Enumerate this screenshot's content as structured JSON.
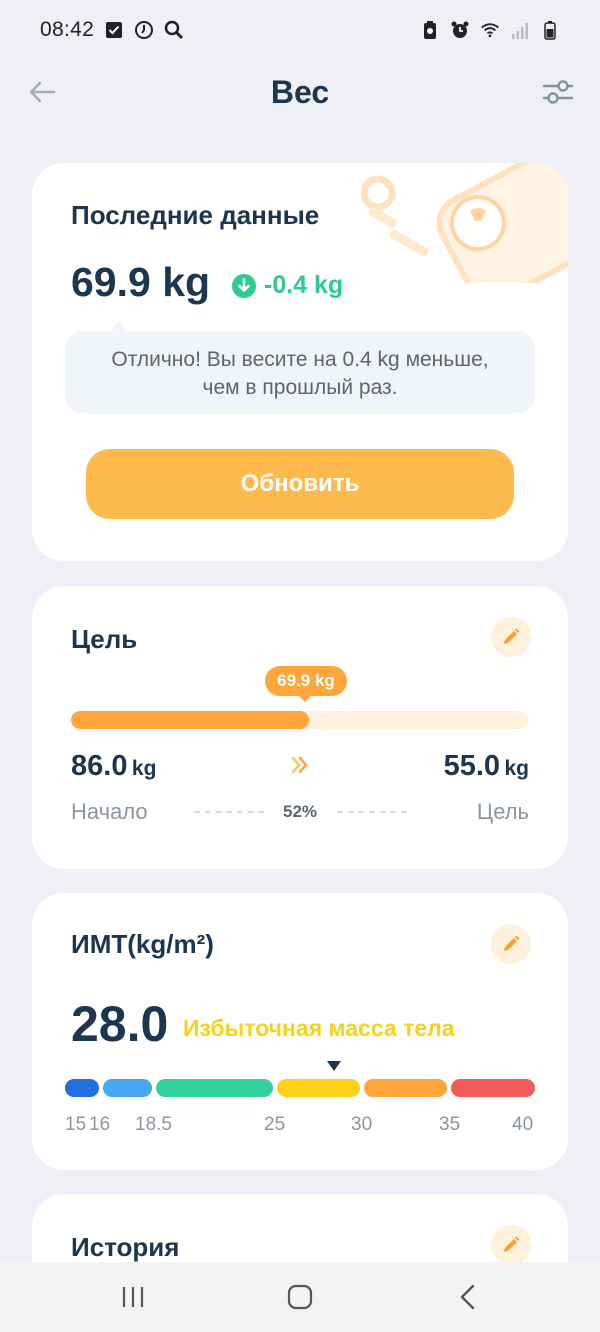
{
  "status_bar": {
    "time": "08:42"
  },
  "header": {
    "title": "Вес"
  },
  "latest": {
    "title": "Последние данные",
    "weight": "69.9 kg",
    "delta": "-0.4 kg",
    "message_line1": "Отлично! Вы весите на 0.4 kg меньше,",
    "message_line2": "чем в прошлый раз.",
    "update_label": "Обновить"
  },
  "goal": {
    "title": "Цель",
    "current_badge": "69.9 kg",
    "progress": 0.52,
    "start_value": "86.0",
    "start_unit": "kg",
    "end_value": "55.0",
    "end_unit": "kg",
    "start_label": "Начало",
    "end_label": "Цель",
    "percent_label": "52%"
  },
  "bmi": {
    "title": "ИМТ(kg/m²)",
    "value": "28.0",
    "status": "Избыточная масса тела",
    "ticks": [
      "15",
      "16",
      "18.5",
      "25",
      "30",
      "35",
      "40"
    ],
    "colors": {
      "severe_underweight": "#1f6fe0",
      "underweight": "#45a8f0",
      "normal": "#34d19e",
      "overweight": "#fcd11a",
      "obese1": "#ffa53a",
      "obese2": "#f25b5b"
    }
  },
  "history": {
    "title": "История"
  },
  "colors": {
    "accent": "#ffba4d",
    "positive": "#2ecb8f",
    "text": "#1c3550"
  }
}
